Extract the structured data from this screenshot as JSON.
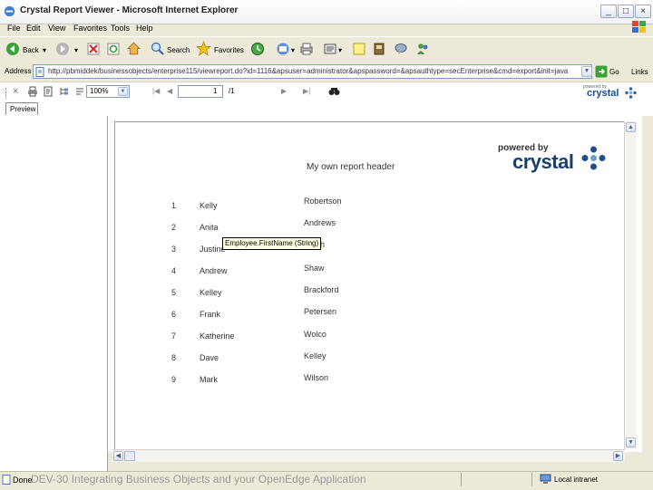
{
  "window": {
    "title": "Crystal Report Viewer - Microsoft Internet Explorer"
  },
  "menu": {
    "items": [
      "File",
      "Edit",
      "View",
      "Favorites",
      "Tools",
      "Help"
    ]
  },
  "toolbar": {
    "back_label": "Back",
    "search_label": "Search",
    "favorites_label": "Favorites"
  },
  "address": {
    "label": "Address",
    "url": "http://pbmiddek/businessobjects/enterprise115/viewreport.do?id=1116&apsuser=administrator&apspassword=&apsauthtype=secEnterprise&cmd=export&init=java",
    "go_label": "Go",
    "links_label": "Links"
  },
  "crystal_toolbar": {
    "zoom_value": "100%",
    "page_value": "1",
    "page_of": "/1"
  },
  "tabs": {
    "preview_label": "Preview"
  },
  "report": {
    "header": "My own report header",
    "tooltip": "Employee.FirstName (String)",
    "rows": [
      {
        "num": "1",
        "first": "Kelly",
        "last": "Robertson"
      },
      {
        "num": "2",
        "first": "Anita",
        "last": "Andrews"
      },
      {
        "num": "3",
        "first": "Justine",
        "last": "Smith"
      },
      {
        "num": "4",
        "first": "Andrew",
        "last": "Shaw"
      },
      {
        "num": "5",
        "first": "Kelley",
        "last": "Brackford"
      },
      {
        "num": "6",
        "first": "Frank",
        "last": "Petersen"
      },
      {
        "num": "7",
        "first": "Katherine",
        "last": "Wolco"
      },
      {
        "num": "8",
        "first": "Dave",
        "last": "Kelley"
      },
      {
        "num": "9",
        "first": "Mark",
        "last": "Wilson"
      }
    ]
  },
  "brand": {
    "powered_by": "powered by",
    "crystal": "crystal"
  },
  "status": {
    "done": "Done",
    "caption": "DEV-30 Integrating Business Objects and your OpenEdge Application",
    "zone": "Local intranet"
  },
  "colors": {
    "xp_blue": "#0a246a",
    "crystal_blue": "#1b4f8e"
  }
}
